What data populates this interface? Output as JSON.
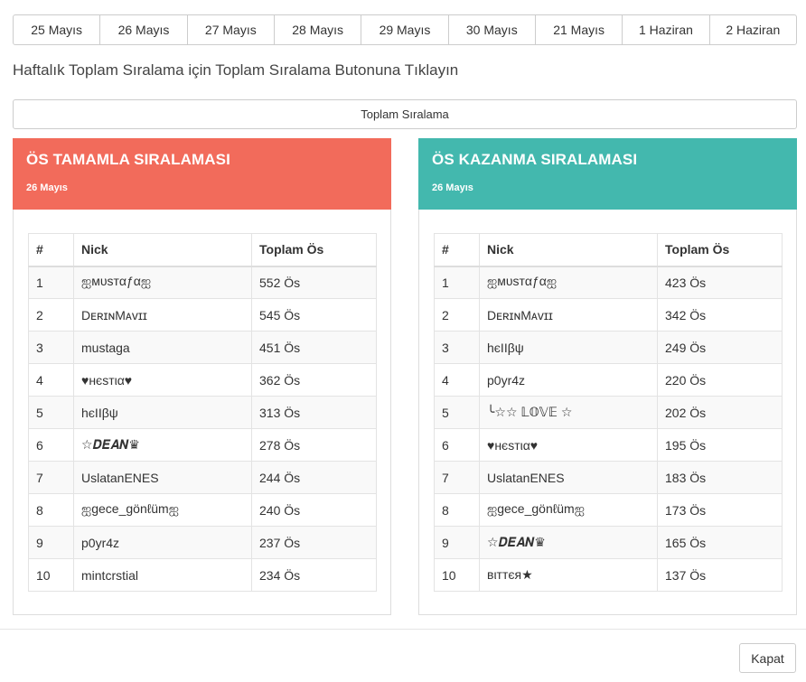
{
  "dates": [
    "25 Mayıs",
    "26 Mayıs",
    "27 Mayıs",
    "28 Mayıs",
    "29 Mayıs",
    "30 Mayıs",
    "21 Mayıs",
    "1 Haziran",
    "2 Haziran"
  ],
  "instruction": "Haftalık Toplam Sıralama için Toplam Sıralama Butonuna Tıklayın",
  "total_button": "Toplam Sıralama",
  "colors": {
    "left_header": "#f26b5b",
    "right_header": "#43b8ae"
  },
  "left": {
    "title": "ÖS TAMAMLA SIRALAMASI",
    "date": "26 Mayıs",
    "headers": [
      "#",
      "Nick",
      "Toplam Ös"
    ],
    "rows": [
      [
        "1",
        "ஐмυѕтαƒαஐ",
        "552 Ös"
      ],
      [
        "2",
        "DᴇʀɪɴMᴀᴠɪɪ",
        "545 Ös"
      ],
      [
        "3",
        "mustaga",
        "451 Ös"
      ],
      [
        "4",
        "♥нєѕтια♥",
        "362 Ös"
      ],
      [
        "5",
        "һєΙΙβψ",
        "313 Ös"
      ],
      [
        "6",
        "☆𝑫𝑬𝑨𝑵♛",
        "278 Ös"
      ],
      [
        "7",
        "UslatanENES",
        "244 Ös"
      ],
      [
        "8",
        "ஐgece_gönℓümஐ",
        "240 Ös"
      ],
      [
        "9",
        "p0yr4z",
        "237 Ös"
      ],
      [
        "10",
        "mintcrstial",
        "234 Ös"
      ]
    ]
  },
  "right": {
    "title": "ÖS KAZANMA SIRALAMASI",
    "date": "26 Mayıs",
    "headers": [
      "#",
      "Nick",
      "Toplam Ös"
    ],
    "rows": [
      [
        "1",
        "ஐмυѕтαƒαஐ",
        "423 Ös"
      ],
      [
        "2",
        "DᴇʀɪɴMᴀᴠɪɪ",
        "342 Ös"
      ],
      [
        "3",
        "һєΙΙβψ",
        "249 Ös"
      ],
      [
        "4",
        "p0yr4z",
        "220 Ös"
      ],
      [
        "5",
        "╰☆☆ 𝕃𝕆𝕍𝔼 ☆",
        "202 Ös"
      ],
      [
        "6",
        "♥нєѕтια♥",
        "195 Ös"
      ],
      [
        "7",
        "UslatanENES",
        "183 Ös"
      ],
      [
        "8",
        "ஐgece_gönℓümஐ",
        "173 Ös"
      ],
      [
        "9",
        "☆𝑫𝑬𝑨𝑵♛",
        "165 Ös"
      ],
      [
        "10",
        "вιттєя★",
        "137 Ös"
      ]
    ]
  },
  "close_button": "Kapat"
}
